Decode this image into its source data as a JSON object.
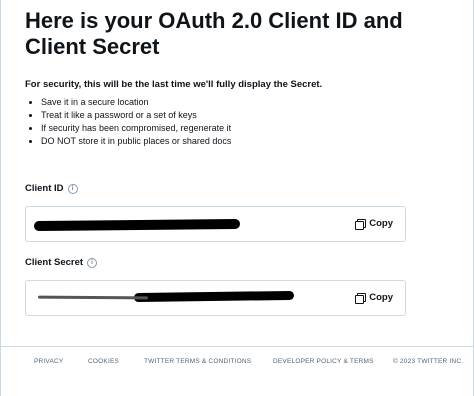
{
  "heading": "Here is your OAuth 2.0 Client ID and Client Secret",
  "warning": "For security, this will be the last time we'll fully display the Secret.",
  "tips": [
    "Save it in a secure location",
    "Treat it like a password or a set of keys",
    "If security has been compromised, regenerate it",
    "DO NOT store it in public places or shared docs"
  ],
  "client_id": {
    "label": "Client ID",
    "info_icon": "info-circle-icon",
    "value": "",
    "copy_label": "Copy",
    "copy_icon": "copy-icon"
  },
  "client_secret": {
    "label": "Client Secret",
    "info_icon": "info-circle-icon",
    "value": "",
    "copy_label": "Copy",
    "copy_icon": "copy-icon"
  },
  "footer": {
    "links": [
      "PRIVACY",
      "COOKIES",
      "TWITTER TERMS & CONDITIONS",
      "DEVELOPER POLICY & TERMS"
    ],
    "copyright": "© 2023 TWITTER INC."
  }
}
